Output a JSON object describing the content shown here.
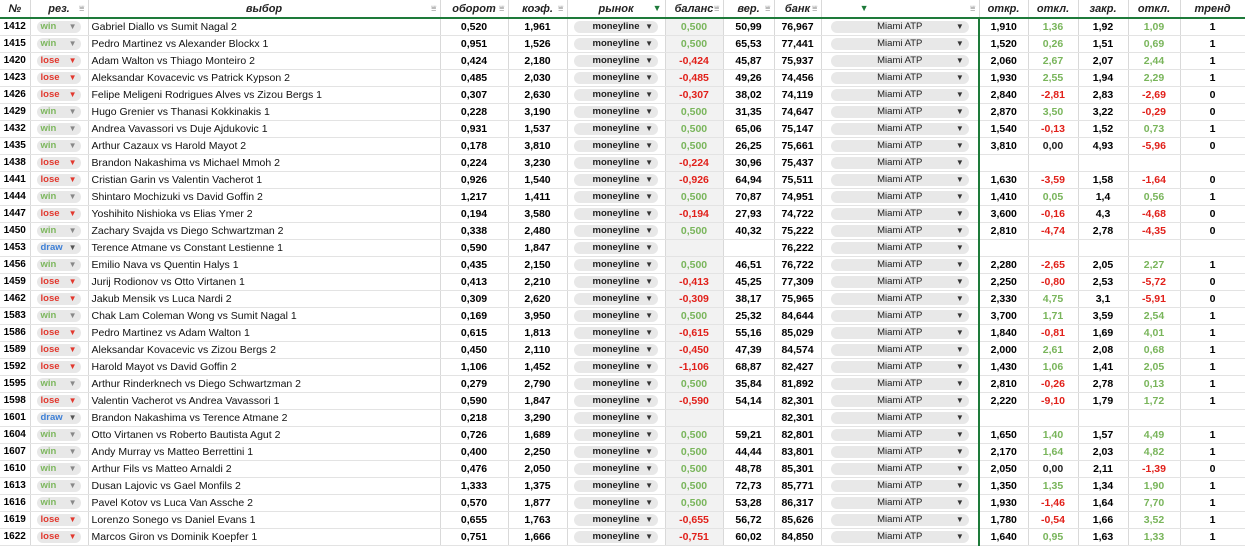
{
  "headers": {
    "id": "№",
    "res": "рез.",
    "sel": "выбор",
    "turnover": "оборот",
    "odds": "коэф.",
    "market": "рынок",
    "balance": "баланс",
    "prob": "вер.",
    "bank": "банк",
    "open": "откр.",
    "dev1": "откл.",
    "close": "закр.",
    "dev2": "откл.",
    "trend": "тренд"
  },
  "colors": {
    "accent": "#1e7a3a",
    "win": "#7db75e",
    "lose": "#e2382e",
    "draw": "#3d7fd6"
  },
  "rows": [
    {
      "id": "1412",
      "res": "win",
      "sel": "Gabriel Diallo  vs  Sumit Nagal 2",
      "turnover": "0,520",
      "odds": "1,961",
      "market": "moneyline",
      "balance": "0,500",
      "prob": "50,99",
      "bank": "76,967",
      "tour": "Miami ATP",
      "open": "1,910",
      "dev1": "1,36",
      "close": "1,92",
      "dev2": "1,09",
      "trend": "1"
    },
    {
      "id": "1415",
      "res": "win",
      "sel": "Pedro Martinez  vs  Alexander Blockx 1",
      "turnover": "0,951",
      "odds": "1,526",
      "market": "moneyline",
      "balance": "0,500",
      "prob": "65,53",
      "bank": "77,441",
      "tour": "Miami ATP",
      "open": "1,520",
      "dev1": "0,26",
      "close": "1,51",
      "dev2": "0,69",
      "trend": "1"
    },
    {
      "id": "1420",
      "res": "lose",
      "sel": "Adam Walton  vs  Thiago Monteiro 2",
      "turnover": "0,424",
      "odds": "2,180",
      "market": "moneyline",
      "balance": "-0,424",
      "prob": "45,87",
      "bank": "75,937",
      "tour": "Miami ATP",
      "open": "2,060",
      "dev1": "2,67",
      "close": "2,07",
      "dev2": "2,44",
      "trend": "1"
    },
    {
      "id": "1423",
      "res": "lose",
      "sel": "Aleksandar Kovacevic  vs  Patrick Kypson 2",
      "turnover": "0,485",
      "odds": "2,030",
      "market": "moneyline",
      "balance": "-0,485",
      "prob": "49,26",
      "bank": "74,456",
      "tour": "Miami ATP",
      "open": "1,930",
      "dev1": "2,55",
      "close": "1,94",
      "dev2": "2,29",
      "trend": "1"
    },
    {
      "id": "1426",
      "res": "lose",
      "sel": "Felipe Meligeni Rodrigues Alves  vs  Zizou Bergs 1",
      "turnover": "0,307",
      "odds": "2,630",
      "market": "moneyline",
      "balance": "-0,307",
      "prob": "38,02",
      "bank": "74,119",
      "tour": "Miami ATP",
      "open": "2,840",
      "dev1": "-2,81",
      "close": "2,83",
      "dev2": "-2,69",
      "trend": "0"
    },
    {
      "id": "1429",
      "res": "win",
      "sel": "Hugo Grenier  vs  Thanasi Kokkinakis 1",
      "turnover": "0,228",
      "odds": "3,190",
      "market": "moneyline",
      "balance": "0,500",
      "prob": "31,35",
      "bank": "74,647",
      "tour": "Miami ATP",
      "open": "2,870",
      "dev1": "3,50",
      "close": "3,22",
      "dev2": "-0,29",
      "trend": "0"
    },
    {
      "id": "1432",
      "res": "win",
      "sel": "Andrea Vavassori  vs  Duje Ajdukovic 1",
      "turnover": "0,931",
      "odds": "1,537",
      "market": "moneyline",
      "balance": "0,500",
      "prob": "65,06",
      "bank": "75,147",
      "tour": "Miami ATP",
      "open": "1,540",
      "dev1": "-0,13",
      "close": "1,52",
      "dev2": "0,73",
      "trend": "1"
    },
    {
      "id": "1435",
      "res": "win",
      "sel": "Arthur Cazaux  vs  Harold Mayot 2",
      "turnover": "0,178",
      "odds": "3,810",
      "market": "moneyline",
      "balance": "0,500",
      "prob": "26,25",
      "bank": "75,661",
      "tour": "Miami ATP",
      "open": "3,810",
      "dev1": "0,00",
      "close": "4,93",
      "dev2": "-5,96",
      "trend": "0"
    },
    {
      "id": "1438",
      "res": "lose",
      "sel": "Brandon Nakashima  vs  Michael Mmoh 2",
      "turnover": "0,224",
      "odds": "3,230",
      "market": "moneyline",
      "balance": "-0,224",
      "prob": "30,96",
      "bank": "75,437",
      "tour": "Miami ATP",
      "open": "",
      "dev1": "",
      "close": "",
      "dev2": "",
      "trend": ""
    },
    {
      "id": "1441",
      "res": "lose",
      "sel": "Cristian Garin  vs  Valentin Vacherot 1",
      "turnover": "0,926",
      "odds": "1,540",
      "market": "moneyline",
      "balance": "-0,926",
      "prob": "64,94",
      "bank": "75,511",
      "tour": "Miami ATP",
      "open": "1,630",
      "dev1": "-3,59",
      "close": "1,58",
      "dev2": "-1,64",
      "trend": "0"
    },
    {
      "id": "1444",
      "res": "win",
      "sel": "Shintaro Mochizuki  vs  David Goffin 2",
      "turnover": "1,217",
      "odds": "1,411",
      "market": "moneyline",
      "balance": "0,500",
      "prob": "70,87",
      "bank": "74,951",
      "tour": "Miami ATP",
      "open": "1,410",
      "dev1": "0,05",
      "close": "1,4",
      "dev2": "0,56",
      "trend": "1"
    },
    {
      "id": "1447",
      "res": "lose",
      "sel": "Yoshihito Nishioka  vs  Elias Ymer 2",
      "turnover": "0,194",
      "odds": "3,580",
      "market": "moneyline",
      "balance": "-0,194",
      "prob": "27,93",
      "bank": "74,722",
      "tour": "Miami ATP",
      "open": "3,600",
      "dev1": "-0,16",
      "close": "4,3",
      "dev2": "-4,68",
      "trend": "0"
    },
    {
      "id": "1450",
      "res": "win",
      "sel": "Zachary Svajda  vs  Diego Schwartzman 2",
      "turnover": "0,338",
      "odds": "2,480",
      "market": "moneyline",
      "balance": "0,500",
      "prob": "40,32",
      "bank": "75,222",
      "tour": "Miami ATP",
      "open": "2,810",
      "dev1": "-4,74",
      "close": "2,78",
      "dev2": "-4,35",
      "trend": "0"
    },
    {
      "id": "1453",
      "res": "draw",
      "sel": "Terence Atmane  vs  Constant Lestienne 1",
      "turnover": "0,590",
      "odds": "1,847",
      "market": "moneyline",
      "balance": "",
      "prob": "",
      "bank": "76,222",
      "tour": "Miami ATP",
      "open": "",
      "dev1": "",
      "close": "",
      "dev2": "",
      "trend": ""
    },
    {
      "id": "1456",
      "res": "win",
      "sel": "Emilio Nava  vs  Quentin Halys 1",
      "turnover": "0,435",
      "odds": "2,150",
      "market": "moneyline",
      "balance": "0,500",
      "prob": "46,51",
      "bank": "76,722",
      "tour": "Miami ATP",
      "open": "2,280",
      "dev1": "-2,65",
      "close": "2,05",
      "dev2": "2,27",
      "trend": "1"
    },
    {
      "id": "1459",
      "res": "lose",
      "sel": "Jurij Rodionov  vs  Otto Virtanen 1",
      "turnover": "0,413",
      "odds": "2,210",
      "market": "moneyline",
      "balance": "-0,413",
      "prob": "45,25",
      "bank": "77,309",
      "tour": "Miami ATP",
      "open": "2,250",
      "dev1": "-0,80",
      "close": "2,53",
      "dev2": "-5,72",
      "trend": "0"
    },
    {
      "id": "1462",
      "res": "lose",
      "sel": "Jakub Mensik  vs  Luca Nardi 2",
      "turnover": "0,309",
      "odds": "2,620",
      "market": "moneyline",
      "balance": "-0,309",
      "prob": "38,17",
      "bank": "75,965",
      "tour": "Miami ATP",
      "open": "2,330",
      "dev1": "4,75",
      "close": "3,1",
      "dev2": "-5,91",
      "trend": "0"
    },
    {
      "id": "1583",
      "res": "win",
      "sel": "Chak Lam Coleman Wong  vs  Sumit Nagal 1",
      "turnover": "0,169",
      "odds": "3,950",
      "market": "moneyline",
      "balance": "0,500",
      "prob": "25,32",
      "bank": "84,644",
      "tour": "Miami ATP",
      "open": "3,700",
      "dev1": "1,71",
      "close": "3,59",
      "dev2": "2,54",
      "trend": "1"
    },
    {
      "id": "1586",
      "res": "lose",
      "sel": "Pedro Martinez  vs  Adam Walton 1",
      "turnover": "0,615",
      "odds": "1,813",
      "market": "moneyline",
      "balance": "-0,615",
      "prob": "55,16",
      "bank": "85,029",
      "tour": "Miami ATP",
      "open": "1,840",
      "dev1": "-0,81",
      "close": "1,69",
      "dev2": "4,01",
      "trend": "1"
    },
    {
      "id": "1589",
      "res": "lose",
      "sel": "Aleksandar Kovacevic  vs  Zizou Bergs 2",
      "turnover": "0,450",
      "odds": "2,110",
      "market": "moneyline",
      "balance": "-0,450",
      "prob": "47,39",
      "bank": "84,574",
      "tour": "Miami ATP",
      "open": "2,000",
      "dev1": "2,61",
      "close": "2,08",
      "dev2": "0,68",
      "trend": "1"
    },
    {
      "id": "1592",
      "res": "lose",
      "sel": "Harold Mayot  vs  David Goffin 2",
      "turnover": "1,106",
      "odds": "1,452",
      "market": "moneyline",
      "balance": "-1,106",
      "prob": "68,87",
      "bank": "82,427",
      "tour": "Miami ATP",
      "open": "1,430",
      "dev1": "1,06",
      "close": "1,41",
      "dev2": "2,05",
      "trend": "1"
    },
    {
      "id": "1595",
      "res": "win",
      "sel": "Arthur Rinderknech  vs  Diego Schwartzman 2",
      "turnover": "0,279",
      "odds": "2,790",
      "market": "moneyline",
      "balance": "0,500",
      "prob": "35,84",
      "bank": "81,892",
      "tour": "Miami ATP",
      "open": "2,810",
      "dev1": "-0,26",
      "close": "2,78",
      "dev2": "0,13",
      "trend": "1"
    },
    {
      "id": "1598",
      "res": "lose",
      "sel": "Valentin Vacherot  vs  Andrea Vavassori 1",
      "turnover": "0,590",
      "odds": "1,847",
      "market": "moneyline",
      "balance": "-0,590",
      "prob": "54,14",
      "bank": "82,301",
      "tour": "Miami ATP",
      "open": "2,220",
      "dev1": "-9,10",
      "close": "1,79",
      "dev2": "1,72",
      "trend": "1"
    },
    {
      "id": "1601",
      "res": "draw",
      "sel": "Brandon Nakashima  vs  Terence Atmane 2",
      "turnover": "0,218",
      "odds": "3,290",
      "market": "moneyline",
      "balance": "",
      "prob": "",
      "bank": "82,301",
      "tour": "Miami ATP",
      "open": "",
      "dev1": "",
      "close": "",
      "dev2": "",
      "trend": ""
    },
    {
      "id": "1604",
      "res": "win",
      "sel": "Otto Virtanen  vs  Roberto Bautista Agut 2",
      "turnover": "0,726",
      "odds": "1,689",
      "market": "moneyline",
      "balance": "0,500",
      "prob": "59,21",
      "bank": "82,801",
      "tour": "Miami ATP",
      "open": "1,650",
      "dev1": "1,40",
      "close": "1,57",
      "dev2": "4,49",
      "trend": "1"
    },
    {
      "id": "1607",
      "res": "win",
      "sel": "Andy Murray  vs  Matteo Berrettini 1",
      "turnover": "0,400",
      "odds": "2,250",
      "market": "moneyline",
      "balance": "0,500",
      "prob": "44,44",
      "bank": "83,801",
      "tour": "Miami ATP",
      "open": "2,170",
      "dev1": "1,64",
      "close": "2,03",
      "dev2": "4,82",
      "trend": "1"
    },
    {
      "id": "1610",
      "res": "win",
      "sel": "Arthur Fils  vs  Matteo Arnaldi 2",
      "turnover": "0,476",
      "odds": "2,050",
      "market": "moneyline",
      "balance": "0,500",
      "prob": "48,78",
      "bank": "85,301",
      "tour": "Miami ATP",
      "open": "2,050",
      "dev1": "0,00",
      "close": "2,11",
      "dev2": "-1,39",
      "trend": "0"
    },
    {
      "id": "1613",
      "res": "win",
      "sel": "Dusan Lajovic  vs  Gael Monfils 2",
      "turnover": "1,333",
      "odds": "1,375",
      "market": "moneyline",
      "balance": "0,500",
      "prob": "72,73",
      "bank": "85,771",
      "tour": "Miami ATP",
      "open": "1,350",
      "dev1": "1,35",
      "close": "1,34",
      "dev2": "1,90",
      "trend": "1"
    },
    {
      "id": "1616",
      "res": "win",
      "sel": " Pavel Kotov  vs  Luca Van Assche 2",
      "turnover": "0,570",
      "odds": "1,877",
      "market": "moneyline",
      "balance": "0,500",
      "prob": "53,28",
      "bank": "86,317",
      "tour": "Miami ATP",
      "open": "1,930",
      "dev1": "-1,46",
      "close": "1,64",
      "dev2": "7,70",
      "trend": "1"
    },
    {
      "id": "1619",
      "res": "lose",
      "sel": "Lorenzo Sonego  vs  Daniel Evans 1",
      "turnover": "0,655",
      "odds": "1,763",
      "market": "moneyline",
      "balance": "-0,655",
      "prob": "56,72",
      "bank": "85,626",
      "tour": "Miami ATP",
      "open": "1,780",
      "dev1": "-0,54",
      "close": "1,66",
      "dev2": "3,52",
      "trend": "1"
    },
    {
      "id": "1622",
      "res": "lose",
      "sel": "Marcos Giron  vs  Dominik Koepfer 1",
      "turnover": "0,751",
      "odds": "1,666",
      "market": "moneyline",
      "balance": "-0,751",
      "prob": "60,02",
      "bank": "84,850",
      "tour": "Miami ATP",
      "open": "1,640",
      "dev1": "0,95",
      "close": "1,63",
      "dev2": "1,33",
      "trend": "1"
    }
  ]
}
